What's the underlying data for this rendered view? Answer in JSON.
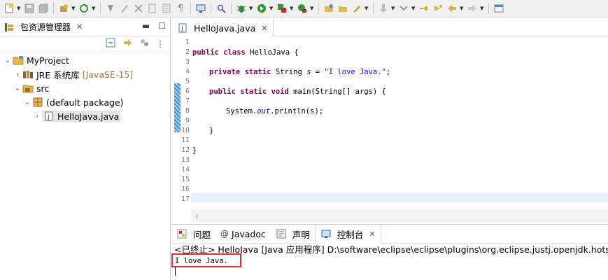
{
  "toolbar": {
    "icons": [
      "new-icon",
      "save-icon",
      "save-all-icon",
      "new-project-icon",
      "refresh-icon",
      "pin-icon",
      "marker-icon",
      "compare-icon",
      "page-icon",
      "pilcrow-icon",
      "monitor-icon",
      "search-icon",
      "debug-icon",
      "run-icon",
      "coverage-icon",
      "external-tools-icon",
      "open-type-icon",
      "open-folder-icon",
      "pencil-icon",
      "down-arrow-icon",
      "next-annotation-icon",
      "prev-annotation-icon",
      "back-icon",
      "forward-icon",
      "perspective-icon"
    ]
  },
  "left_panel": {
    "tab_label": "包资源管理器",
    "tree": [
      {
        "label": "MyProject",
        "level": 0,
        "expanded": true,
        "icon": "project-folder-icon"
      },
      {
        "label": "JRE 系统库",
        "deco": "[JavaSE-15]",
        "level": 1,
        "expanded": false,
        "icon": "library-icon"
      },
      {
        "label": "src",
        "level": 1,
        "expanded": true,
        "icon": "source-folder-icon"
      },
      {
        "label": "(default package)",
        "level": 2,
        "expanded": true,
        "icon": "package-icon"
      },
      {
        "label": "HelloJava.java",
        "level": 3,
        "expanded": false,
        "icon": "java-file-icon",
        "selected": true
      }
    ]
  },
  "editor": {
    "tab_label": "HelloJava.java",
    "line_numbers": [
      "1",
      "2",
      "3",
      "4",
      "5",
      "6",
      "7",
      "8",
      "9",
      "10",
      "11",
      "12",
      "13",
      "14",
      "15",
      "16",
      "17"
    ],
    "code": {
      "l2_kw": "public class",
      "l2_rest": " HelloJava {",
      "l4_kw": "private static",
      "l4_mid": " String ",
      "l4_var": "s",
      "l4_eq": " = ",
      "l4_str": "\"I love Java.\"",
      "l4_end": ";",
      "l6_kw": "public static void",
      "l6_rest": " main(String[] args) {",
      "l8_a": "System.",
      "l8_out": "out",
      "l8_b": ".println(",
      "l8_s": "s",
      "l8_c": ");",
      "l10": "}",
      "l12": "}"
    }
  },
  "bottom_panel": {
    "tabs": [
      {
        "label": "问题",
        "icon": "problems-icon"
      },
      {
        "label": "Javadoc",
        "icon": "at-icon"
      },
      {
        "label": "声明",
        "icon": "declaration-icon"
      },
      {
        "label": "控制台",
        "icon": "console-icon",
        "active": true
      }
    ],
    "console_header": "<已终止> HelloJava [Java 应用程序] D:\\software\\eclipse\\eclipse\\plugins\\org.eclipse.justj.openjdk.hotspot.jre",
    "console_output": "I love Java."
  }
}
